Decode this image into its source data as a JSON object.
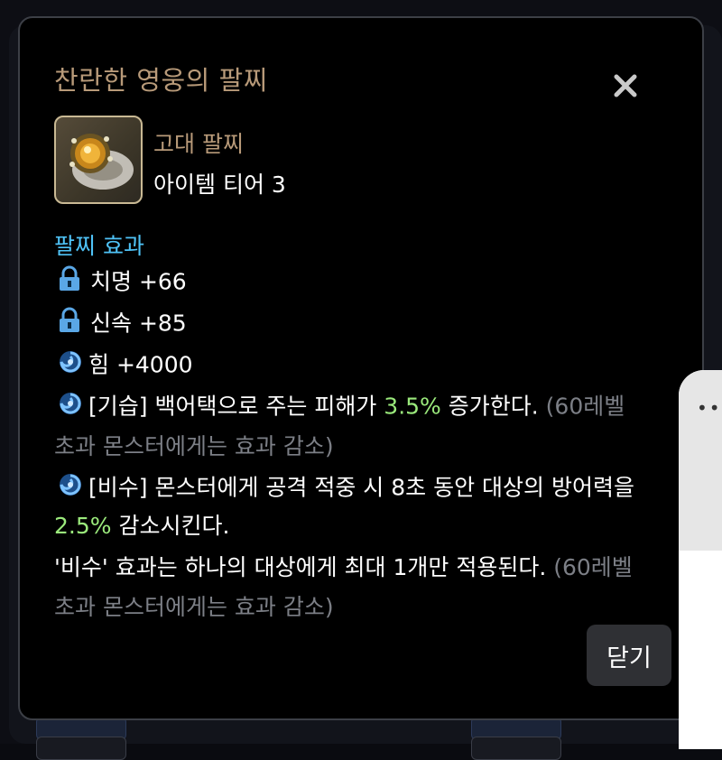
{
  "dialog": {
    "title": "찬란한 영웅의 팔찌",
    "close_icon": "close-icon",
    "item": {
      "icon": "bracelet-item-icon",
      "grade": "고대 팔찌",
      "tier": "아이템 티어 3"
    },
    "effects_header": "팔찌 효과",
    "effects": [
      {
        "icon": "lock-icon",
        "text": "치명 +66"
      },
      {
        "icon": "lock-icon",
        "text": "신속 +85"
      },
      {
        "icon": "swirl-icon",
        "text": "힘 +4000"
      },
      {
        "icon": "swirl-icon",
        "prefix": "[기습] 백어택으로 주는 피해가 ",
        "highlight": "3.5%",
        "suffix": " 증가한다. ",
        "note_line1": "(60레벨",
        "note_line2": "초과 몬스터에게는 효과 감소)"
      },
      {
        "icon": "swirl-icon",
        "line1": "[비수] 몬스터에게 공격 적중 시 8초 동안 대상의 방어력을",
        "highlight": "2.5%",
        "line2_suffix": " 감소시킨다.",
        "line3": "'비수' 효과는 하나의 대상에게 최대 1개만 적용된다. ",
        "note_line1": "(60레벨",
        "note_line2": "초과 몬스터에게는 효과 감소)"
      }
    ],
    "close_button_label": "닫기"
  },
  "side_panel": {
    "more_icon": "more-dots-icon",
    "dots": "••"
  },
  "colors": {
    "title": "#b89a79",
    "header": "#4fc3f7",
    "highlight": "#9bea7c",
    "note": "#7c7f86"
  }
}
